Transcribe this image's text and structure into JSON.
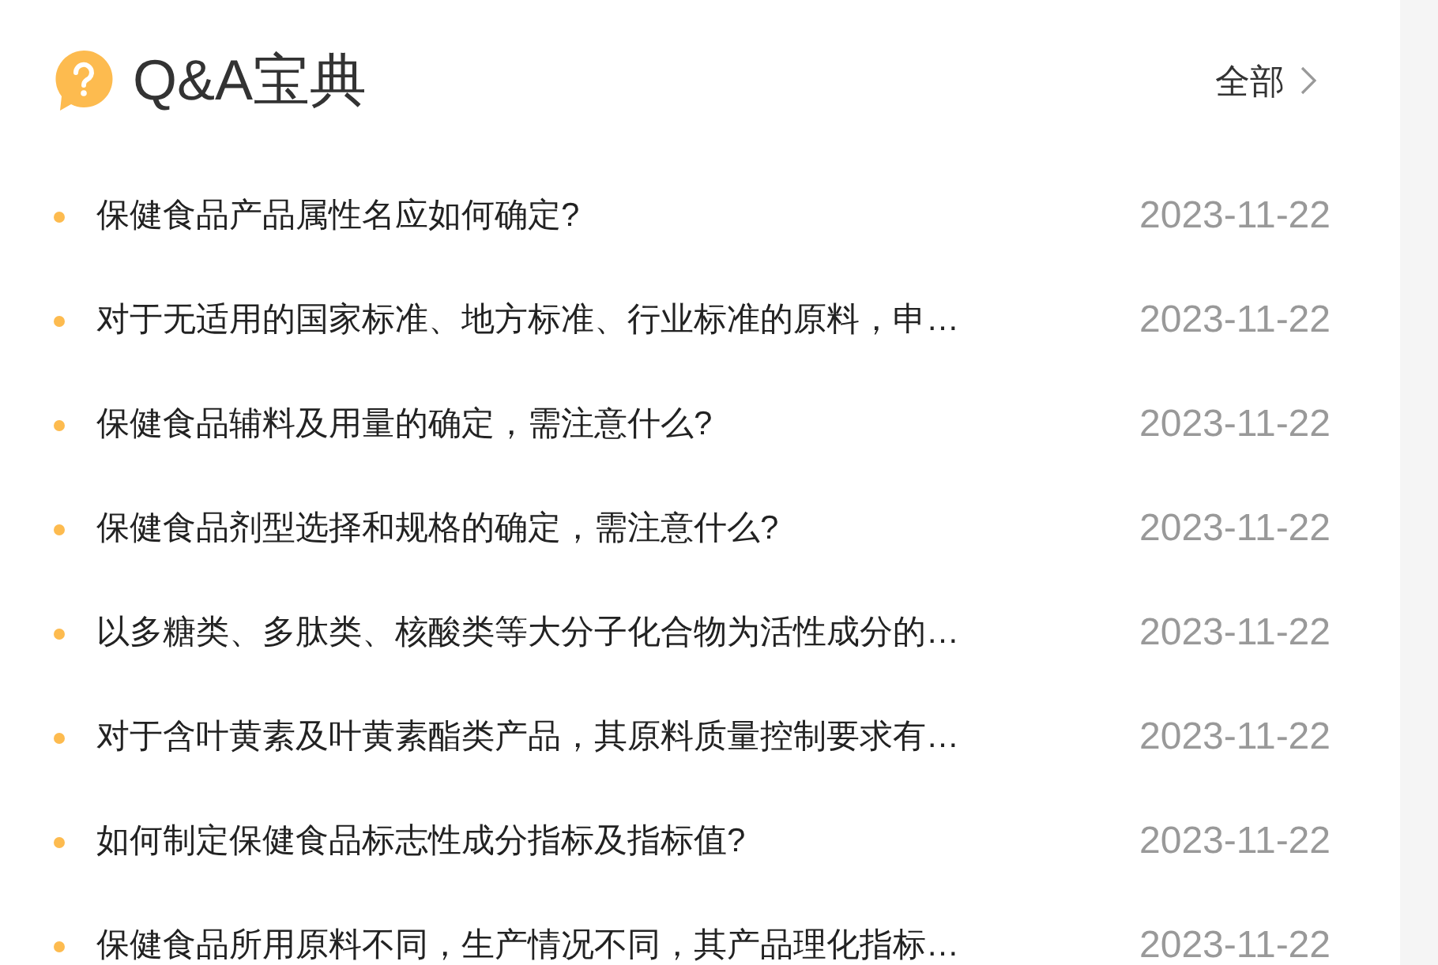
{
  "header": {
    "title": "Q&A宝典",
    "more_link": "全部"
  },
  "items": [
    {
      "title": "保健食品产品属性名应如何确定?",
      "date": "2023-11-22"
    },
    {
      "title": "对于无适用的国家标准、地方标准、行业标准的原料，申…",
      "date": "2023-11-22"
    },
    {
      "title": "保健食品辅料及用量的确定，需注意什么?",
      "date": "2023-11-22"
    },
    {
      "title": "保健食品剂型选择和规格的确定，需注意什么?",
      "date": "2023-11-22"
    },
    {
      "title": "以多糖类、多肽类、核酸类等大分子化合物为活性成分的…",
      "date": "2023-11-22"
    },
    {
      "title": "对于含叶黄素及叶黄素酯类产品，其原料质量控制要求有…",
      "date": "2023-11-22"
    },
    {
      "title": "如何制定保健食品标志性成分指标及指标值?",
      "date": "2023-11-22"
    },
    {
      "title": "保健食品所用原料不同，生产情况不同，其产品理化指标…",
      "date": "2023-11-22"
    }
  ]
}
